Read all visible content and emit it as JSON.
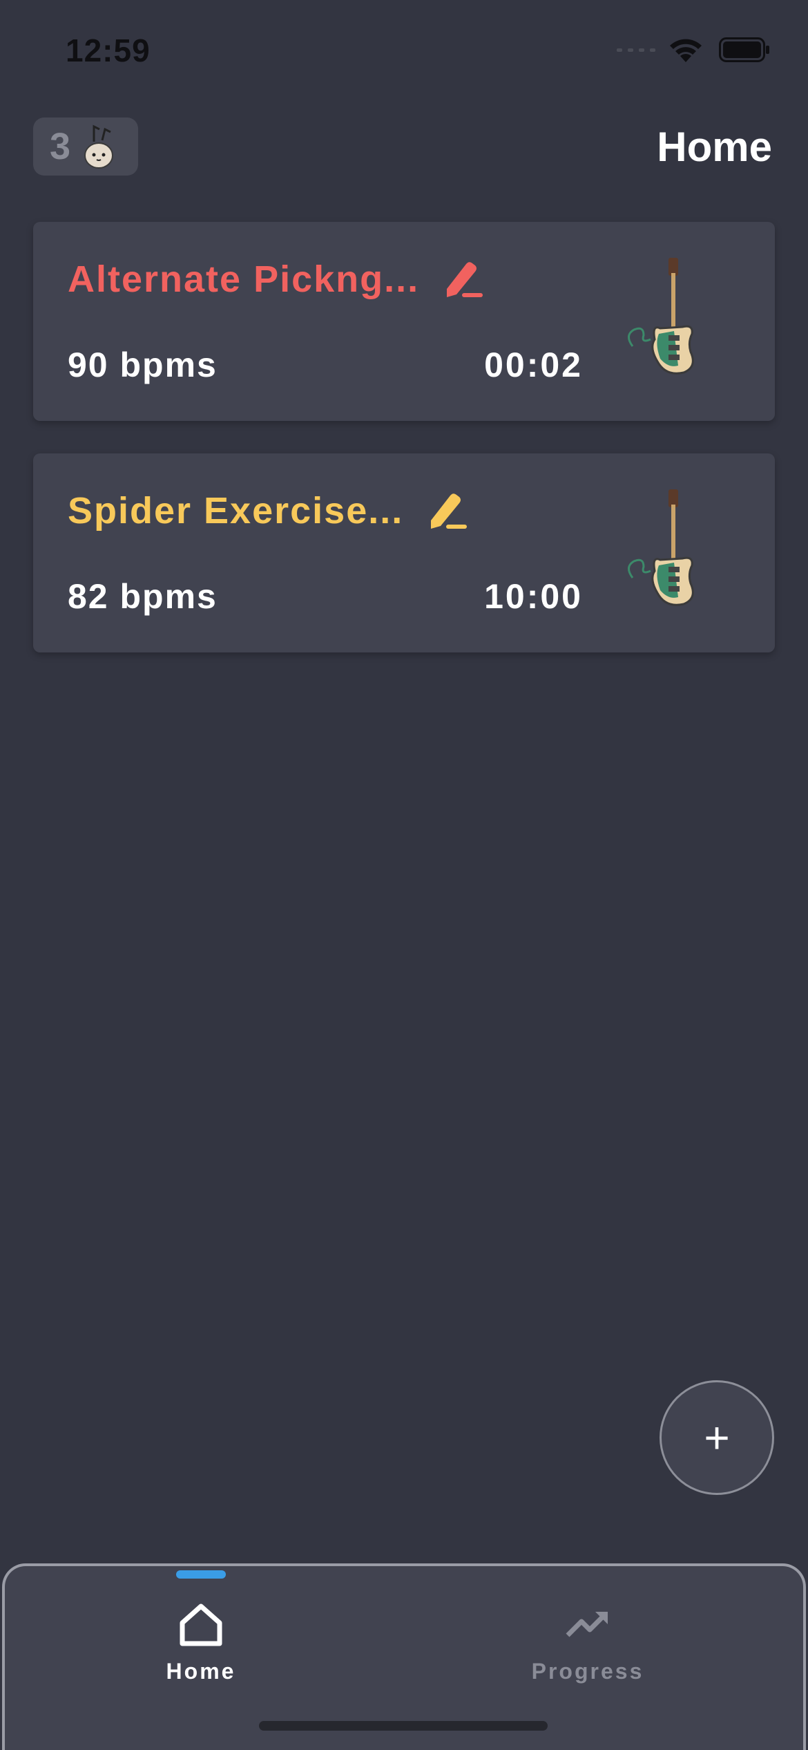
{
  "status_bar": {
    "time": "12:59"
  },
  "header": {
    "streak_count": "3",
    "title": "Home"
  },
  "exercises": [
    {
      "title": "Alternate Pickng...",
      "bpm": "90 bpms",
      "time": "00:02",
      "color": "#f1625f"
    },
    {
      "title": "Spider Exercise...",
      "bpm": "82 bpms",
      "time": "10:00",
      "color": "#f8c95a"
    }
  ],
  "fab": {
    "label": "+"
  },
  "tabbar": {
    "tabs": [
      {
        "label": "Home",
        "icon": "home-icon",
        "active": true
      },
      {
        "label": "Progress",
        "icon": "trending-up-icon",
        "active": false
      }
    ],
    "accent": "#3a9de6"
  }
}
